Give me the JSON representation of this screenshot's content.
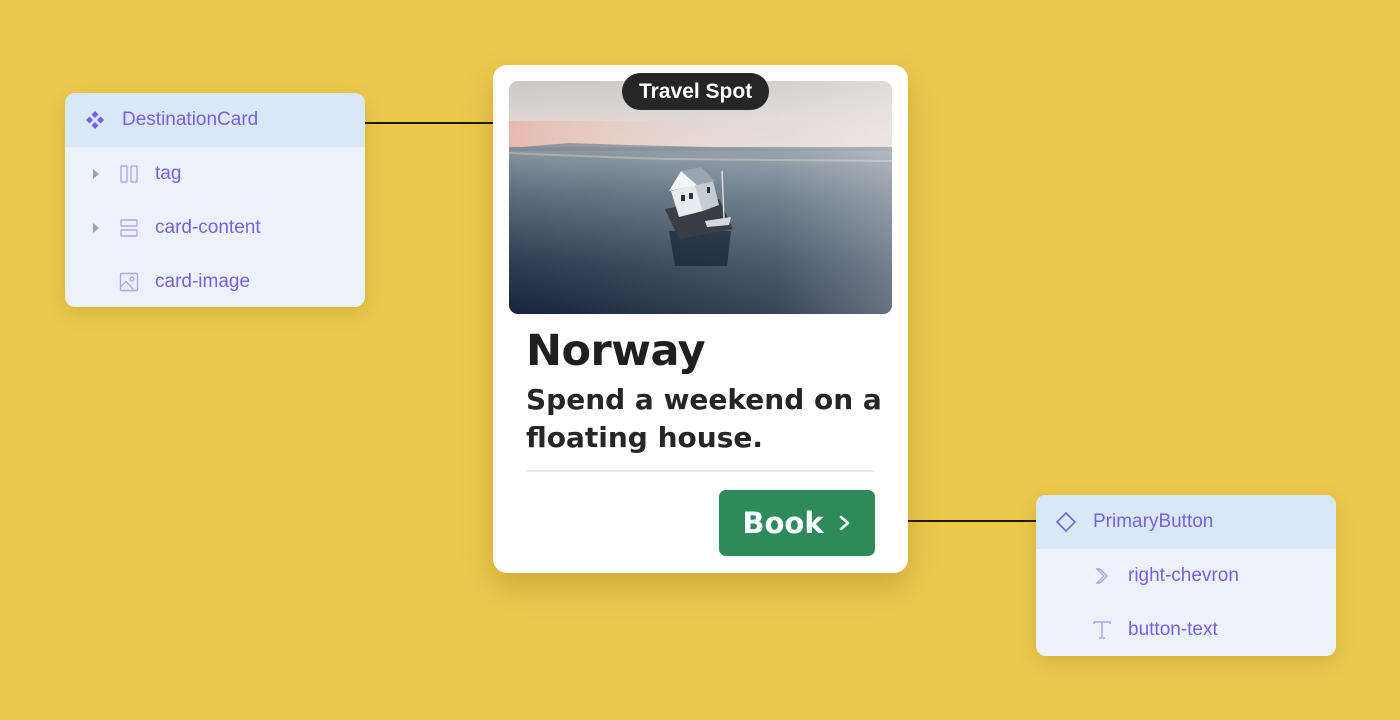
{
  "destination_panel": {
    "root_label": "DestinationCard",
    "root_icon": "component-icon",
    "layers": [
      {
        "label": "tag",
        "icon": "columns-icon",
        "expandable": true
      },
      {
        "label": "card-content",
        "icon": "rows-icon",
        "expandable": true
      },
      {
        "label": "card-image",
        "icon": "image-icon",
        "expandable": false
      }
    ]
  },
  "card": {
    "tag": "Travel Spot",
    "title": "Norway",
    "description": "Spend a weekend on a floating house.",
    "button_label": "Book",
    "button_icon": "chevron-right-icon",
    "image_icon": "floating-house-photo",
    "colors": {
      "button": "#2e8a5b",
      "tag": "#262626",
      "background": "#ecc94b"
    }
  },
  "button_panel": {
    "root_label": "PrimaryButton",
    "root_icon": "instance-icon",
    "layers": [
      {
        "label": "right-chevron",
        "icon": "chevron-right-icon"
      },
      {
        "label": "button-text",
        "icon": "text-icon"
      }
    ]
  }
}
